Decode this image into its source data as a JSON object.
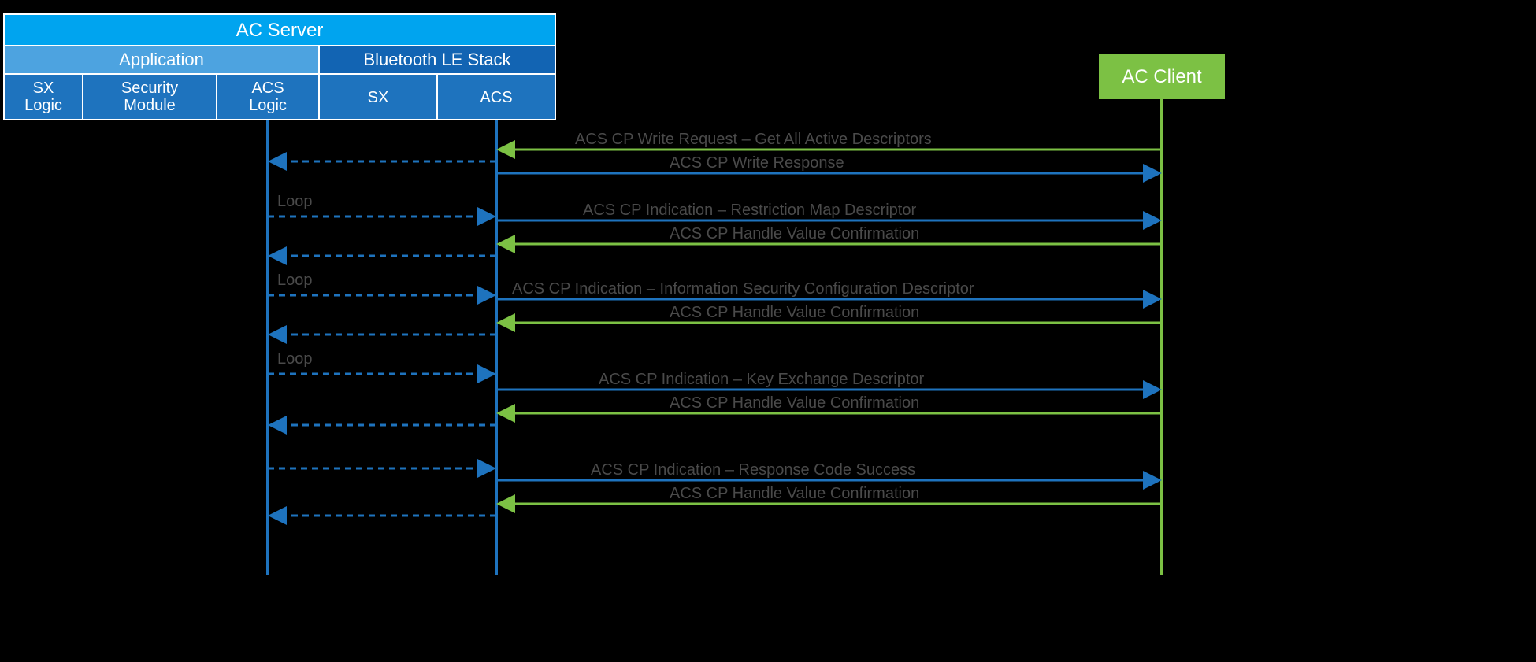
{
  "server": {
    "title": "AC Server",
    "app": {
      "title": "Application",
      "slots": [
        "SX Logic",
        "Security Module",
        "ACS Logic"
      ]
    },
    "stack": {
      "title": "Bluetooth LE Stack",
      "slots": [
        "SX",
        "ACS"
      ]
    }
  },
  "client": {
    "title": "AC Client"
  },
  "labels": {
    "loop": "Loop"
  },
  "messages": {
    "m1": "ACS CP Write Request – Get All Active Descriptors",
    "m2": "ACS CP Write Response",
    "m3": "ACS CP Indication – Restriction Map Descriptor",
    "m4": "ACS CP Handle Value Confirmation",
    "m5": "ACS CP Indication – Information Security Configuration Descriptor",
    "m6": "ACS CP Handle Value Confirmation",
    "m7": "ACS CP Indication – Key Exchange Descriptor",
    "m8": "ACS CP Handle Value Confirmation",
    "m9": "ACS CP Indication – Response Code Success",
    "m10": "ACS CP Handle Value Confirmation"
  },
  "colors": {
    "brightBlue": "#00A4EF",
    "medBlue": "#4DA3E0",
    "slotBlue": "#1E73BE",
    "stackBlue": "#1264B3",
    "green": "#7CC144",
    "arrowBlue": "#1E73BE",
    "arrowGreen": "#7CC144",
    "text": "#4a4a4a",
    "white": "#ffffff"
  }
}
